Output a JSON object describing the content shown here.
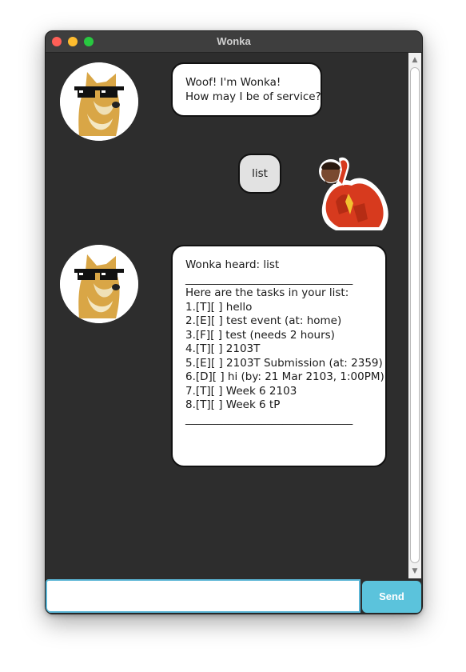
{
  "window": {
    "title": "Wonka"
  },
  "messages": [
    {
      "sender": "bot",
      "lines": [
        "Woof! I'm Wonka!",
        "How may I be of service?"
      ]
    },
    {
      "sender": "user",
      "lines": [
        "list"
      ]
    },
    {
      "sender": "bot",
      "lines": [
        "Wonka heard: list",
        "_______________________________",
        "",
        "Here are the tasks in your list:",
        "1.[T][ ] hello",
        "2.[E][ ] test event (at: home)",
        "3.[F][ ] test (needs 2 hours)",
        "4.[T][ ] 2103T",
        "5.[E][ ] 2103T Submission (at: 2359)",
        "6.[D][ ] hi (by: 21 Mar 2103, 1:00PM)",
        "7.[T][ ] Week 6 2103",
        "8.[T][ ] Week 6 tP",
        "",
        "",
        "_______________________________"
      ]
    }
  ],
  "avatars": {
    "bot": "doge-sunglasses-icon",
    "user": "drake-icon"
  },
  "input": {
    "value": "",
    "placeholder": ""
  },
  "send_button": {
    "label": "Send"
  },
  "colors": {
    "accent": "#5bc3dc",
    "chat_background": "#2d2d2d",
    "bubble": "#ffffff"
  }
}
